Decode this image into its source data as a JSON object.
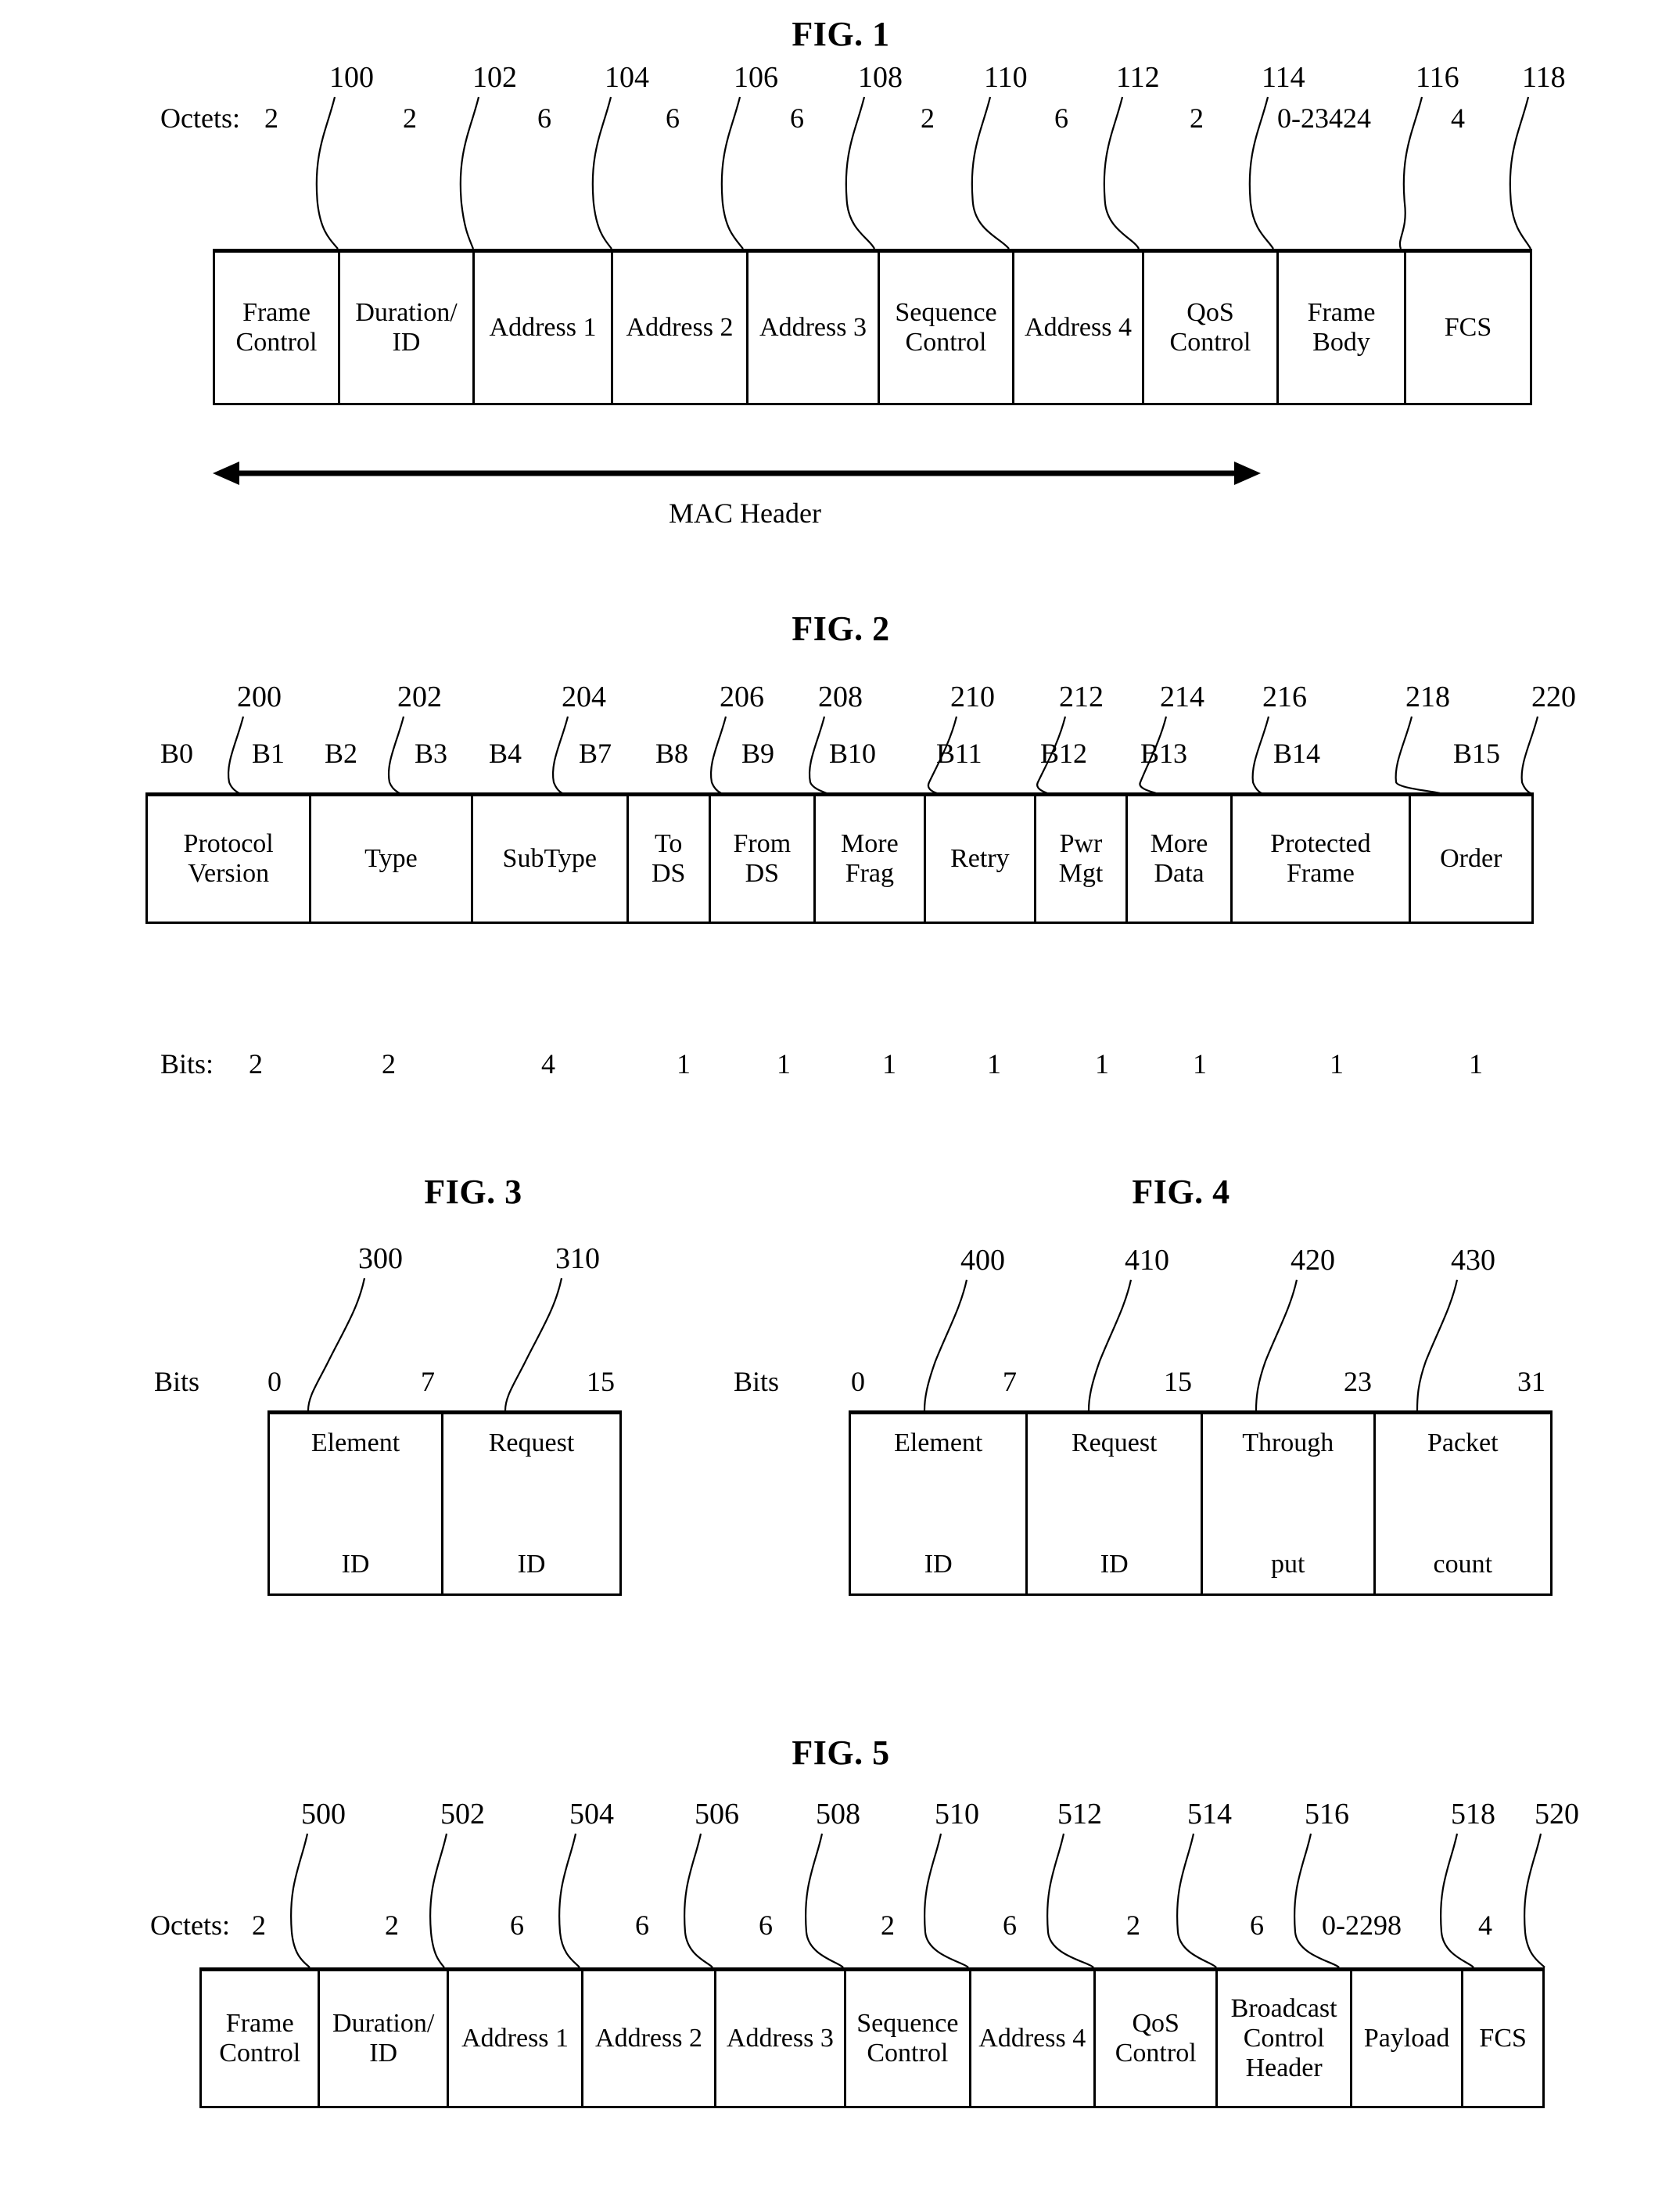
{
  "figures": [
    {
      "title": "FIG. 1",
      "size_label": "Octets:",
      "ref_numbers": [
        "100",
        "102",
        "104",
        "106",
        "108",
        "110",
        "112",
        "114",
        "116",
        "118"
      ],
      "sizes": [
        "2",
        "2",
        "6",
        "6",
        "6",
        "2",
        "6",
        "2",
        "0-23424",
        "4"
      ],
      "cells": [
        {
          "line1": "Frame",
          "line2": "Control"
        },
        {
          "line1": "Duration/",
          "line2": "ID"
        },
        {
          "line1": "Address 1",
          "line2": ""
        },
        {
          "line1": "Address 2",
          "line2": ""
        },
        {
          "line1": "Address 3",
          "line2": ""
        },
        {
          "line1": "Sequence",
          "line2": "Control"
        },
        {
          "line1": "Address 4",
          "line2": ""
        },
        {
          "line1": "QoS",
          "line2": "Control"
        },
        {
          "line1": "Frame",
          "line2": "Body"
        },
        {
          "line1": "FCS",
          "line2": ""
        }
      ],
      "span_label": "MAC Header"
    },
    {
      "title": "FIG. 2",
      "size_label": "Bits:",
      "ref_numbers": [
        "200",
        "202",
        "204",
        "206",
        "208",
        "210",
        "212",
        "214",
        "216",
        "218",
        "220"
      ],
      "bit_labels": [
        "B0",
        "B1",
        "B2",
        "B3",
        "B4",
        "B7",
        "B8",
        "B9",
        "B10",
        "B11",
        "B12",
        "B13",
        "B14",
        "B15"
      ],
      "sizes": [
        "2",
        "2",
        "4",
        "1",
        "1",
        "1",
        "1",
        "1",
        "1",
        "1",
        "1"
      ],
      "cells": [
        {
          "line1": "Protocol",
          "line2": "Version"
        },
        {
          "line1": "",
          "line2": "Type"
        },
        {
          "line1": "",
          "line2": "SubType"
        },
        {
          "line1": "To",
          "line2": "DS"
        },
        {
          "line1": "From",
          "line2": "DS"
        },
        {
          "line1": "More",
          "line2": "Frag"
        },
        {
          "line1": "",
          "line2": "Retry"
        },
        {
          "line1": "Pwr",
          "line2": "Mgt"
        },
        {
          "line1": "More",
          "line2": "Data"
        },
        {
          "line1": "Protected",
          "line2": "Frame"
        },
        {
          "line1": "",
          "line2": "Order"
        }
      ]
    },
    {
      "title": "FIG. 3",
      "size_label": "Bits",
      "ref_numbers": [
        "300",
        "310"
      ],
      "bit_ticks": [
        "0",
        "7",
        "15"
      ],
      "cells": [
        {
          "line1": "Element",
          "line2": "ID"
        },
        {
          "line1": "Request",
          "line2": "ID"
        }
      ]
    },
    {
      "title": "FIG. 4",
      "size_label": "Bits",
      "ref_numbers": [
        "400",
        "410",
        "420",
        "430"
      ],
      "bit_ticks": [
        "0",
        "7",
        "15",
        "23",
        "31"
      ],
      "cells": [
        {
          "line1": "Element",
          "line2": "ID"
        },
        {
          "line1": "Request",
          "line2": "ID"
        },
        {
          "line1": "Through",
          "line2": "put"
        },
        {
          "line1": "Packet",
          "line2": "count"
        }
      ]
    },
    {
      "title": "FIG. 5",
      "size_label": "Octets:",
      "ref_numbers": [
        "500",
        "502",
        "504",
        "506",
        "508",
        "510",
        "512",
        "514",
        "516",
        "518",
        "520"
      ],
      "sizes": [
        "2",
        "2",
        "6",
        "6",
        "6",
        "2",
        "6",
        "2",
        "6",
        "0-2298",
        "4"
      ],
      "cells": [
        {
          "line1": "Frame",
          "line2": "Control",
          "line3": ""
        },
        {
          "line1": "Duration/",
          "line2": "ID",
          "line3": ""
        },
        {
          "line1": "Address 1",
          "line2": "",
          "line3": ""
        },
        {
          "line1": "Address 2",
          "line2": "",
          "line3": ""
        },
        {
          "line1": "Address 3",
          "line2": "",
          "line3": ""
        },
        {
          "line1": "Sequence",
          "line2": "Control",
          "line3": ""
        },
        {
          "line1": "Address 4",
          "line2": "",
          "line3": ""
        },
        {
          "line1": "QoS",
          "line2": "Control",
          "line3": ""
        },
        {
          "line1": "Broadcast",
          "line2": "Control",
          "line3": "Header"
        },
        {
          "line1": "Payload",
          "line2": "",
          "line3": ""
        },
        {
          "line1": "FCS",
          "line2": "",
          "line3": ""
        }
      ]
    }
  ]
}
